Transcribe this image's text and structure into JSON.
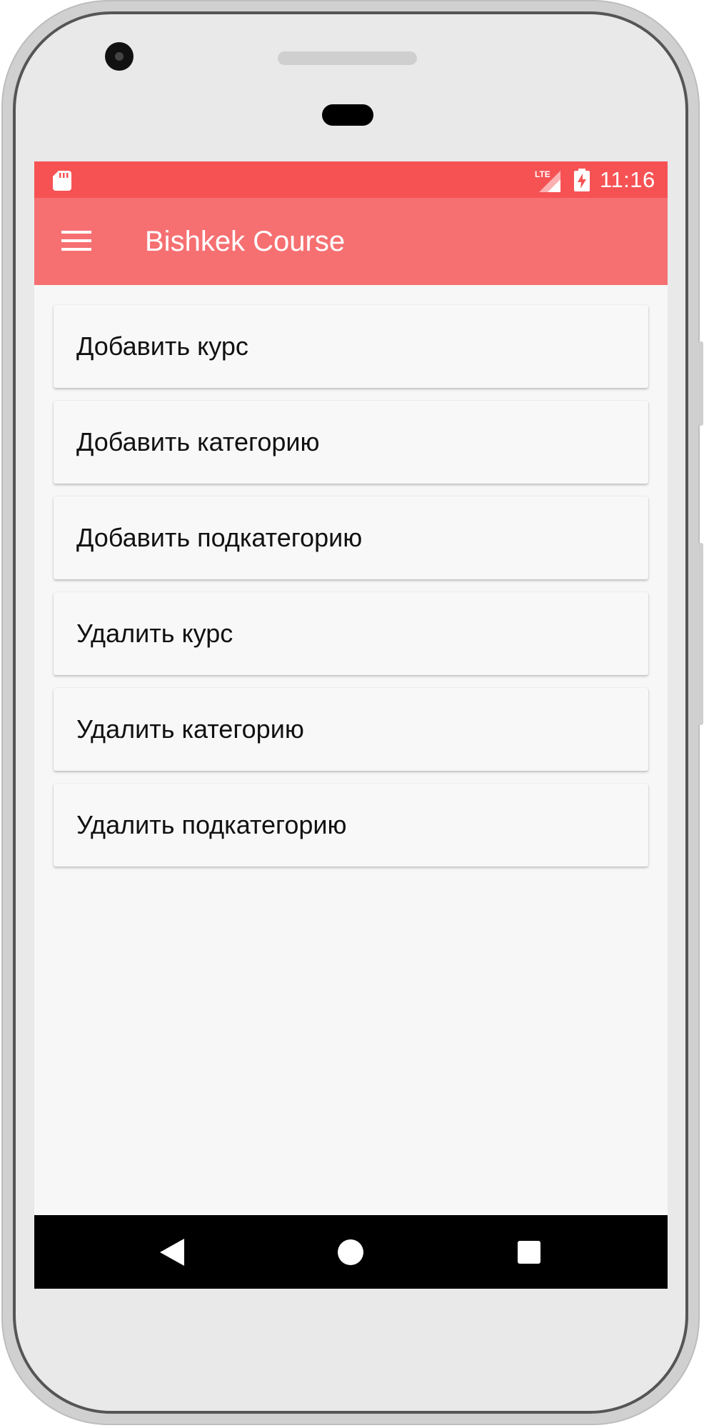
{
  "status_bar": {
    "network_label": "LTE",
    "time": "11:16",
    "color": "#f65254"
  },
  "app_bar": {
    "title": "Bishkek Course",
    "color": "#f67072",
    "menu_icon": "hamburger-menu-icon"
  },
  "menu": {
    "items": [
      {
        "label": "Добавить курс"
      },
      {
        "label": "Добавить категорию"
      },
      {
        "label": "Добавить подкатегорию"
      },
      {
        "label": "Удалить курс"
      },
      {
        "label": "Удалить категорию"
      },
      {
        "label": "Удалить подкатегорию"
      }
    ]
  },
  "nav_bar": {
    "icons": [
      "back-icon",
      "home-icon",
      "recents-icon"
    ]
  }
}
